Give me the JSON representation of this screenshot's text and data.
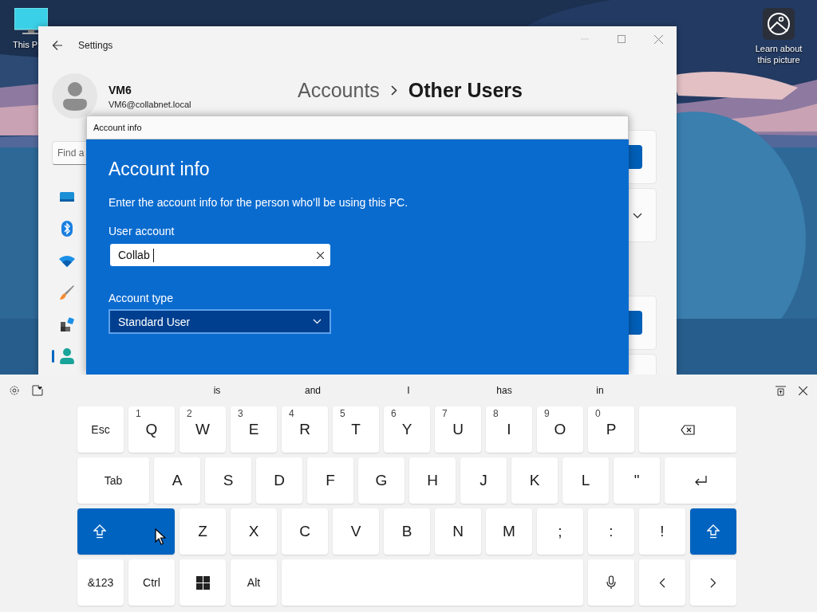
{
  "desktop": {
    "icons": [
      {
        "label": "This P"
      }
    ],
    "spotlight": {
      "label": "Learn about this picture"
    }
  },
  "settings_window": {
    "title": "Settings",
    "user": {
      "name": "VM6",
      "email": "VM6@collabnet.local"
    },
    "search": {
      "placeholder": "Find a"
    },
    "nav_items": [
      {
        "kind": "display",
        "selected": false
      },
      {
        "kind": "bluetooth",
        "selected": false
      },
      {
        "kind": "wifi",
        "selected": false
      },
      {
        "kind": "brush",
        "selected": false
      },
      {
        "kind": "apps",
        "selected": false
      },
      {
        "kind": "person",
        "selected": true
      }
    ],
    "breadcrumb": [
      "Accounts",
      "Other Users"
    ]
  },
  "dialog": {
    "title": "Account info",
    "heading": "Account info",
    "description": "Enter the account info for the person who’ll be using this PC.",
    "user_account": {
      "label": "User account",
      "value": "Collab"
    },
    "account_type": {
      "label": "Account type",
      "value": "Standard User"
    }
  },
  "keyboard": {
    "suggestions": [
      "is",
      "and",
      "I",
      "has",
      "in"
    ],
    "rows": [
      {
        "keys": [
          {
            "kind": "text",
            "label": "Esc"
          },
          {
            "kind": "char",
            "label": "Q",
            "hint": "1"
          },
          {
            "kind": "char",
            "label": "W",
            "hint": "2"
          },
          {
            "kind": "char",
            "label": "E",
            "hint": "3"
          },
          {
            "kind": "char",
            "label": "R",
            "hint": "4"
          },
          {
            "kind": "char",
            "label": "T",
            "hint": "5"
          },
          {
            "kind": "char",
            "label": "Y",
            "hint": "6"
          },
          {
            "kind": "char",
            "label": "U",
            "hint": "7"
          },
          {
            "kind": "char",
            "label": "I",
            "hint": "8"
          },
          {
            "kind": "char",
            "label": "O",
            "hint": "9"
          },
          {
            "kind": "char",
            "label": "P",
            "hint": "0"
          },
          {
            "kind": "backspace"
          }
        ]
      },
      {
        "keys": [
          {
            "kind": "text",
            "label": "Tab"
          },
          {
            "kind": "char",
            "label": "A"
          },
          {
            "kind": "char",
            "label": "S"
          },
          {
            "kind": "char",
            "label": "D"
          },
          {
            "kind": "char",
            "label": "F"
          },
          {
            "kind": "char",
            "label": "G"
          },
          {
            "kind": "char",
            "label": "H"
          },
          {
            "kind": "char",
            "label": "J"
          },
          {
            "kind": "char",
            "label": "K"
          },
          {
            "kind": "char",
            "label": "L"
          },
          {
            "kind": "char",
            "label": "\""
          },
          {
            "kind": "enter"
          }
        ]
      },
      {
        "keys": [
          {
            "kind": "shift",
            "selected": true
          },
          {
            "kind": "char",
            "label": "Z"
          },
          {
            "kind": "char",
            "label": "X"
          },
          {
            "kind": "char",
            "label": "C"
          },
          {
            "kind": "char",
            "label": "V"
          },
          {
            "kind": "char",
            "label": "B"
          },
          {
            "kind": "char",
            "label": "N"
          },
          {
            "kind": "char",
            "label": "M"
          },
          {
            "kind": "char",
            "label": ";"
          },
          {
            "kind": "char",
            "label": ":"
          },
          {
            "kind": "char",
            "label": "!"
          },
          {
            "kind": "shift",
            "selected": true
          }
        ]
      },
      {
        "keys": [
          {
            "kind": "text",
            "label": "&123"
          },
          {
            "kind": "text",
            "label": "Ctrl"
          },
          {
            "kind": "windows"
          },
          {
            "kind": "text",
            "label": "Alt"
          },
          {
            "kind": "space"
          },
          {
            "kind": "mic"
          },
          {
            "kind": "left"
          },
          {
            "kind": "right"
          }
        ]
      }
    ]
  }
}
